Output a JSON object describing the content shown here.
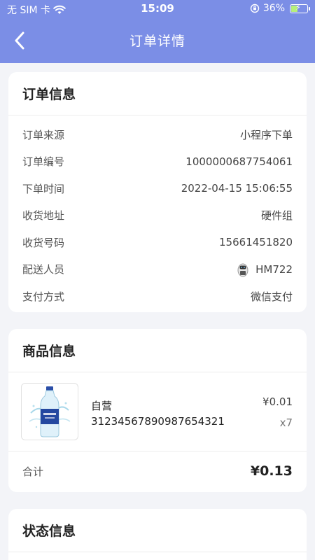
{
  "status_bar": {
    "carrier": "无 SIM 卡",
    "time": "15:09",
    "battery": "36%",
    "battery_level": 0.36
  },
  "nav": {
    "title": "订单详情"
  },
  "order_info": {
    "title": "订单信息",
    "rows": [
      {
        "label": "订单来源",
        "value": "小程序下单"
      },
      {
        "label": "订单编号",
        "value": "1000000687754061"
      },
      {
        "label": "下单时间",
        "value": "2022-04-15 15:06:55"
      },
      {
        "label": "收货地址",
        "value": "硬件组"
      },
      {
        "label": "收货号码",
        "value": "15661451820"
      },
      {
        "label": "配送人员",
        "value": "HM722"
      },
      {
        "label": "支付方式",
        "value": "微信支付"
      }
    ]
  },
  "product_info": {
    "title": "商品信息",
    "item": {
      "brand": "自营",
      "code": "31234567890987654321",
      "price": "¥0.01",
      "qty": "x7"
    },
    "total_label": "合计",
    "total_value": "¥0.13"
  },
  "status_info": {
    "title": "状态信息"
  },
  "colors": {
    "header": "#7b8ee6",
    "background": "#f3f4f8"
  }
}
